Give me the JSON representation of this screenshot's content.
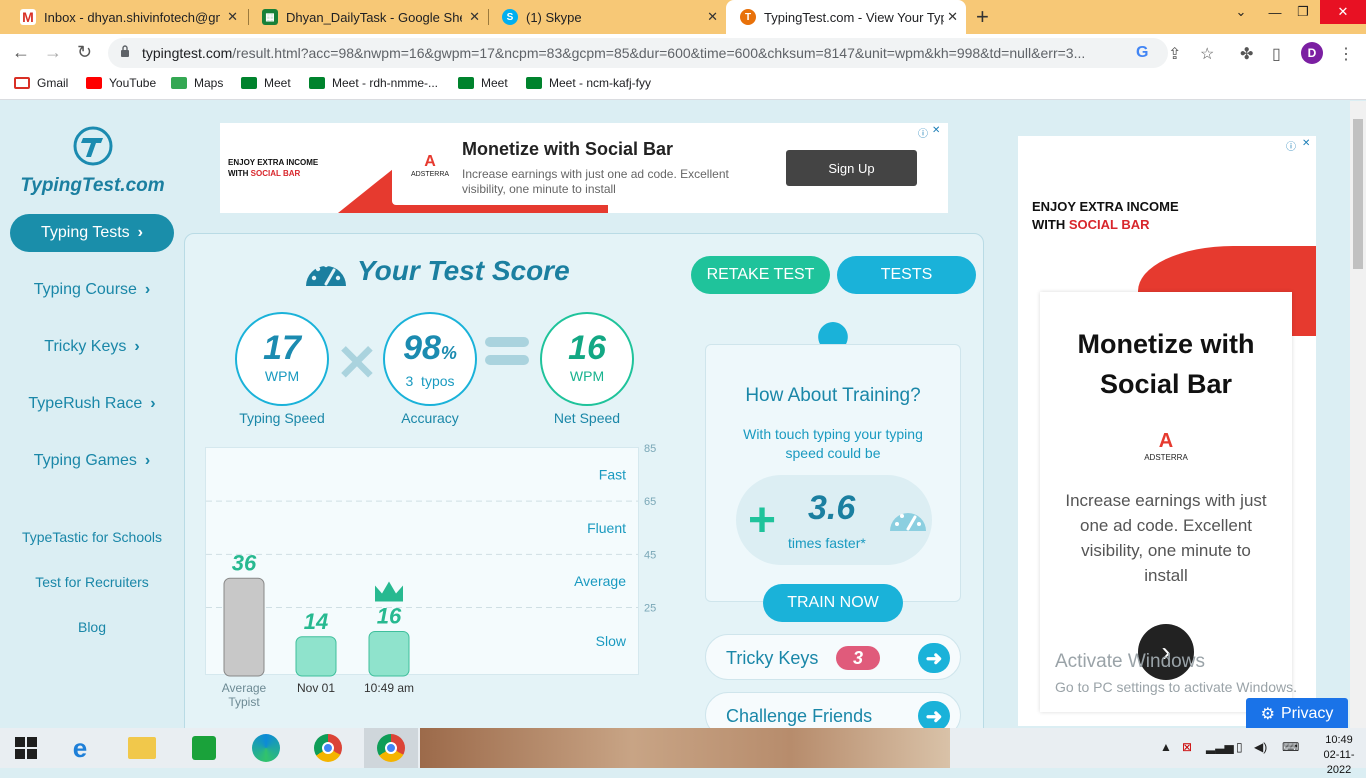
{
  "browser": {
    "tabs": [
      {
        "title": "Inbox - dhyan.shivinfotech@gma",
        "icon": "gmail-icon",
        "color": "#d93025"
      },
      {
        "title": "Dhyan_DailyTask - Google Sheets",
        "icon": "sheets-icon",
        "color": "#188038"
      },
      {
        "title": "(1) Skype",
        "icon": "skype-icon",
        "color": "#00aff0"
      },
      {
        "title": "TypingTest.com - View Your Typin",
        "icon": "typingtest-icon",
        "color": "#e8710a"
      }
    ],
    "url_host": "typingtest.com",
    "url_path": "/result.html?acc=98&nwpm=16&gwpm=17&ncpm=83&gcpm=85&dur=600&time=600&chksum=8147&unit=wpm&kh=998&td=null&err=3...",
    "profile_initial": "D",
    "bookmarks": [
      "Gmail",
      "YouTube",
      "Maps",
      "Meet",
      "Meet - rdh-nmme-...",
      "Meet",
      "Meet - ncm-kafj-fyy"
    ]
  },
  "logo": {
    "text": "TypingTest.com"
  },
  "sidebar": {
    "nav": [
      {
        "label": "Typing Tests",
        "active": true
      },
      {
        "label": "Typing Course",
        "active": false
      },
      {
        "label": "Tricky Keys",
        "active": false
      },
      {
        "label": "TypeRush Race",
        "active": false
      },
      {
        "label": "Typing Games",
        "active": false
      }
    ],
    "links": [
      "TypeTastic for Schools",
      "Test for Recruiters",
      "Blog"
    ]
  },
  "ad_top": {
    "tagline_1": "ENJOY EXTRA INCOME",
    "tagline_2_prefix": "WITH ",
    "tagline_2_accent": "SOCIAL BAR",
    "brand": "ADSTERRA",
    "brand_mark": "A",
    "headline": "Monetize with Social Bar",
    "description": "Increase earnings with just one ad code. Excellent visibility, one minute to install",
    "cta": "Sign Up"
  },
  "score": {
    "title": "Your Test Score",
    "retake_label": "RETAKE TEST",
    "tests_label": "TESTS",
    "typing_speed": {
      "value": "17",
      "unit": "WPM",
      "label": "Typing Speed"
    },
    "accuracy": {
      "value": "98",
      "pct": "%",
      "sub": "3  typos",
      "label": "Accuracy"
    },
    "net_speed": {
      "value": "16",
      "unit": "WPM",
      "label": "Net Speed"
    }
  },
  "chart_data": {
    "type": "bar",
    "categories": [
      "Average Typist",
      "Nov 01",
      "10:49 am"
    ],
    "values": [
      36,
      14,
      16
    ],
    "ylim": [
      0,
      85
    ],
    "yticks": [
      85,
      65,
      45,
      25
    ],
    "bands": [
      "Fast",
      "Fluent",
      "Average",
      "Slow"
    ],
    "colors": [
      "#c8c8c8",
      "#8fe3cc",
      "#8fe3cc"
    ],
    "highlight_index": 2
  },
  "training": {
    "question": "How About Training?",
    "text": "With touch typing your typing speed could be",
    "plus": "+",
    "multiplier": "3.6",
    "multiplier_label": "times faster*",
    "button": "TRAIN NOW"
  },
  "tricky_keys": {
    "label": "Tricky Keys",
    "count": "3"
  },
  "challenge": {
    "label": "Challenge Friends"
  },
  "ad_right": {
    "tagline_1": "ENJOY EXTRA INCOME",
    "tagline_2_prefix": "WITH ",
    "tagline_2_accent": "SOCIAL BAR",
    "headline": "Monetize with Social Bar",
    "brand": "ADSTERRA",
    "brand_mark": "A",
    "description": "Increase earnings with just one ad code. Excellent visibility, one minute to install"
  },
  "watermark": {
    "line1": "Activate Windows",
    "line2": "Go to PC settings to activate Windows."
  },
  "privacy": {
    "label": "Privacy"
  },
  "taskbar": {
    "time": "10:49",
    "date": "02-11-2022"
  }
}
